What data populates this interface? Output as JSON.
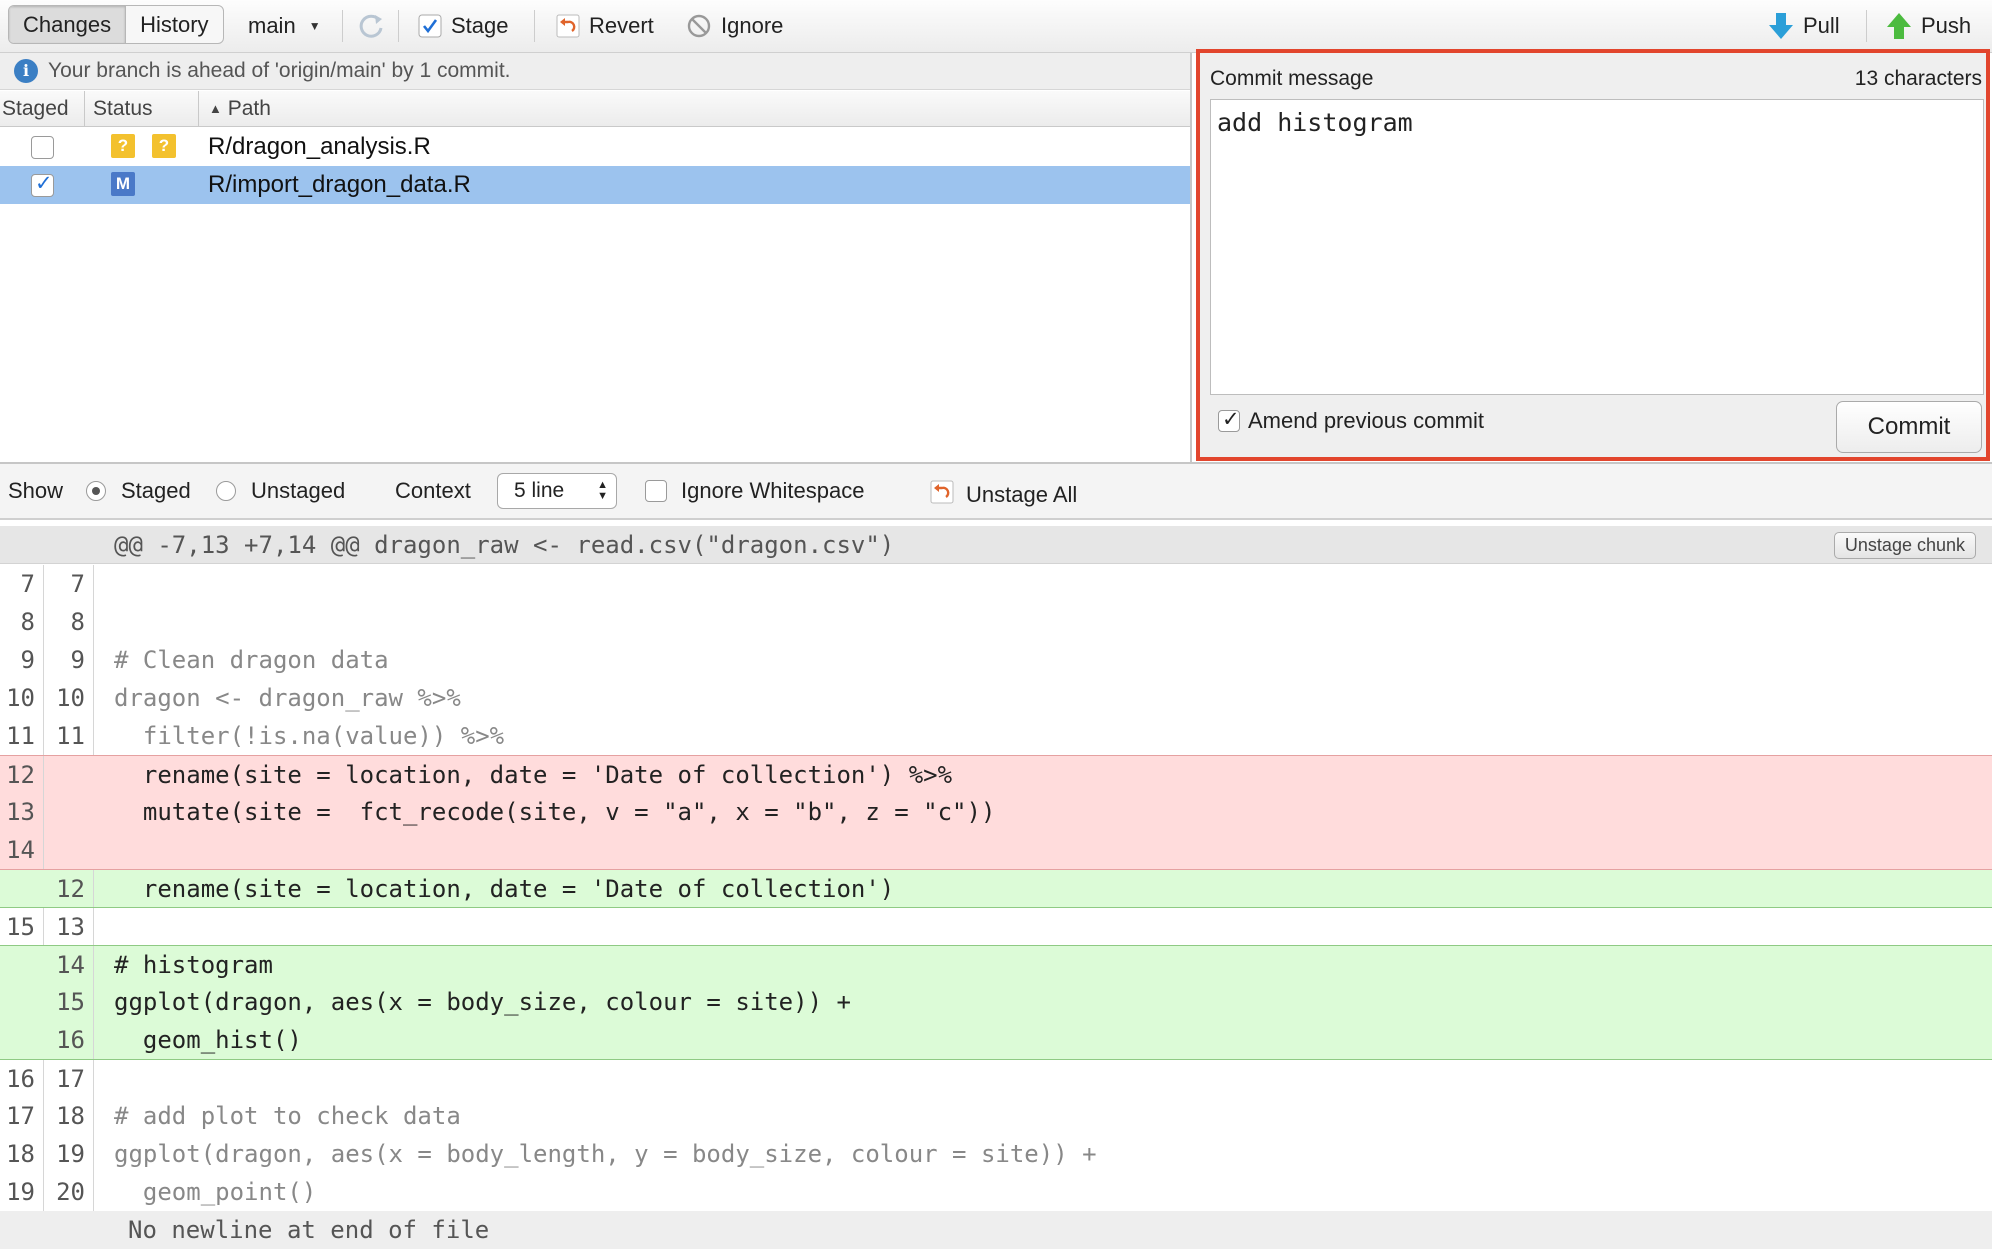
{
  "toolbar": {
    "tabs": [
      "Changes",
      "History"
    ],
    "branch": "main",
    "stage_label": "Stage",
    "revert_label": "Revert",
    "ignore_label": "Ignore",
    "pull_label": "Pull",
    "push_label": "Push"
  },
  "branch_status": "Your branch is ahead of 'origin/main' by 1 commit.",
  "files": {
    "columns": [
      "Staged",
      "Status",
      "Path"
    ],
    "rows": [
      {
        "staged": false,
        "status": [
          "?",
          "?"
        ],
        "path": "R/dragon_analysis.R",
        "selected": false
      },
      {
        "staged": true,
        "status": [
          "M"
        ],
        "path": "R/import_dragon_data.R",
        "selected": true
      }
    ]
  },
  "commit": {
    "label": "Commit message",
    "char_count": "13 characters",
    "message": "add histogram",
    "amend_label": "Amend previous commit",
    "amend_checked": true,
    "button_label": "Commit"
  },
  "diff_toolbar": {
    "show_label": "Show",
    "staged_label": "Staged",
    "unstaged_label": "Unstaged",
    "context_label": "Context",
    "context_value": "5 line",
    "ignore_ws_label": "Ignore Whitespace",
    "unstage_all_label": "Unstage All"
  },
  "hunk": {
    "header": "@@ -7,13 +7,14 @@ dragon_raw <- read.csv(\"dragon.csv\")",
    "button_label": "Unstage chunk"
  },
  "diff_lines": [
    {
      "type": "ctx",
      "old": "7",
      "new": "7",
      "text": ""
    },
    {
      "type": "ctx",
      "old": "8",
      "new": "8",
      "text": ""
    },
    {
      "type": "ctx",
      "old": "9",
      "new": "9",
      "text": "# Clean dragon data"
    },
    {
      "type": "ctx",
      "old": "10",
      "new": "10",
      "text": "dragon <- dragon_raw %>%"
    },
    {
      "type": "ctx",
      "old": "11",
      "new": "11",
      "text": "  filter(!is.na(value)) %>%"
    },
    {
      "type": "del",
      "old": "12",
      "new": "",
      "text": "  rename(site = location, date = 'Date of collection') %>%"
    },
    {
      "type": "del",
      "old": "13",
      "new": "",
      "text": "  mutate(site =  fct_recode(site, v = \"a\", x = \"b\", z = \"c\"))"
    },
    {
      "type": "del",
      "old": "14",
      "new": "",
      "text": ""
    },
    {
      "type": "add",
      "old": "",
      "new": "12",
      "text": "  rename(site = location, date = 'Date of collection')"
    },
    {
      "type": "ctx",
      "old": "15",
      "new": "13",
      "text": ""
    },
    {
      "type": "add",
      "old": "",
      "new": "14",
      "text": "# histogram"
    },
    {
      "type": "add",
      "old": "",
      "new": "15",
      "text": "ggplot(dragon, aes(x = body_size, colour = site)) +"
    },
    {
      "type": "add",
      "old": "",
      "new": "16",
      "text": "  geom_hist()"
    },
    {
      "type": "ctx",
      "old": "16",
      "new": "17",
      "text": ""
    },
    {
      "type": "ctx",
      "old": "17",
      "new": "18",
      "text": "# add plot to check data"
    },
    {
      "type": "ctx",
      "old": "18",
      "new": "19",
      "text": "ggplot(dragon, aes(x = body_length, y = body_size, colour = site)) +"
    },
    {
      "type": "ctx",
      "old": "19",
      "new": "20",
      "text": "  geom_point()"
    },
    {
      "type": "note",
      "old": "",
      "new": "",
      "text": "No newline at end of file"
    }
  ],
  "colors": {
    "highlight_border": "#e2452d",
    "selected_row": "#9cc3ee",
    "deleted_line": "#ffdcdc",
    "added_line": "#dcfbd7",
    "pull_arrow": "#2b9fd8",
    "push_arrow": "#4cbb3f"
  },
  "icons": [
    "refresh-icon",
    "stage-check-icon",
    "revert-icon",
    "ignore-icon",
    "pull-icon",
    "push-icon",
    "info-icon",
    "sort-up-icon",
    "unstage-all-icon"
  ]
}
